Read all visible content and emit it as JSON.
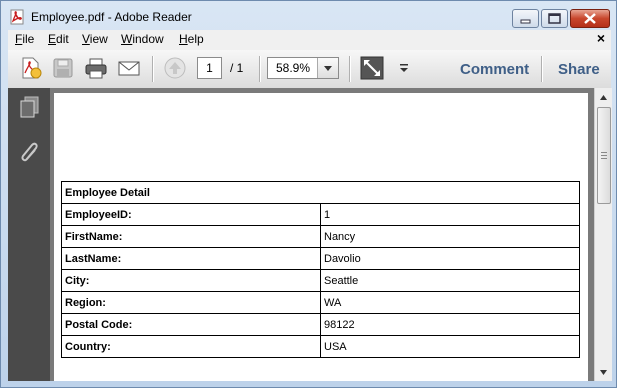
{
  "window": {
    "title": "Employee.pdf - Adobe Reader"
  },
  "menu": {
    "items": [
      {
        "label": "File",
        "accel": "F",
        "rest": "ile"
      },
      {
        "label": "Edit",
        "accel": "E",
        "rest": "dit"
      },
      {
        "label": "View",
        "accel": "V",
        "rest": "iew"
      },
      {
        "label": "Window",
        "accel": "W",
        "rest": "indow"
      },
      {
        "label": "Help",
        "accel": "H",
        "rest": "elp"
      }
    ],
    "close_glyph": "×"
  },
  "toolbar": {
    "page_current": "1",
    "page_total": "/ 1",
    "zoom": "58.9%",
    "comment_label": "Comment",
    "share_label": "Share"
  },
  "document": {
    "table": {
      "header": "Employee Detail",
      "rows": [
        {
          "label": "EmployeeID:",
          "value": "1"
        },
        {
          "label": "FirstName:",
          "value": "Nancy"
        },
        {
          "label": "LastName:",
          "value": "Davolio"
        },
        {
          "label": "City:",
          "value": "Seattle"
        },
        {
          "label": "Region:",
          "value": "WA"
        },
        {
          "label": "Postal Code:",
          "value": "98122"
        },
        {
          "label": "Country:",
          "value": "USA"
        }
      ]
    }
  },
  "icons": {
    "app": "pdf-document-icon",
    "create": "create-pdf-icon",
    "save": "save-icon",
    "print": "print-icon",
    "email": "email-icon",
    "prev_page": "previous-page-icon",
    "fit": "fit-page-icon",
    "more": "toolbar-options-icon",
    "pages": "pages-panel-icon",
    "attachments": "attachments-paperclip-icon"
  },
  "colors": {
    "link": "#3f5f87",
    "nav_pane": "#4a4a4a",
    "doc_bg": "#7a7a7a"
  }
}
